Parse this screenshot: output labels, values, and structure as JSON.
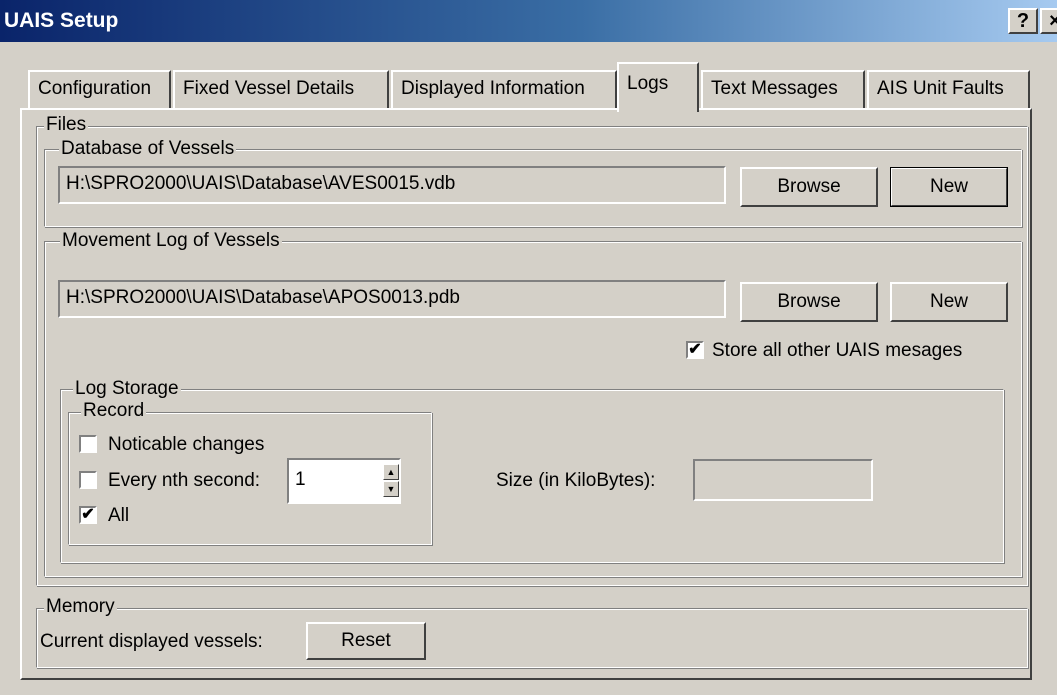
{
  "window": {
    "title": "UAIS Setup",
    "help_glyph": "?",
    "close_glyph": "×"
  },
  "tabs": [
    {
      "label": "Configuration",
      "active": false
    },
    {
      "label": "Fixed Vessel Details",
      "active": false
    },
    {
      "label": "Displayed Information",
      "active": false
    },
    {
      "label": "Logs",
      "active": true
    },
    {
      "label": "Text Messages",
      "active": false
    },
    {
      "label": "AIS Unit Faults",
      "active": false
    }
  ],
  "files": {
    "legend": "Files",
    "database": {
      "legend": "Database of Vessels",
      "path": "H:\\SPRO2000\\UAIS\\Database\\AVES0015.vdb",
      "browse_label": "Browse",
      "new_label": "New"
    },
    "movement": {
      "legend": "Movement Log of Vessels",
      "path": "H:\\SPRO2000\\UAIS\\Database\\APOS0013.pdb",
      "browse_label": "Browse",
      "new_label": "New",
      "store_all_label": "Store all other UAIS mesages",
      "store_all_checked": true,
      "log_storage": {
        "legend": "Log Storage",
        "record": {
          "legend": "Record",
          "noticable_label": "Noticable changes",
          "noticable_checked": false,
          "every_nth_label": "Every nth second:",
          "every_nth_checked": false,
          "every_nth_value": "1",
          "all_label": "All",
          "all_checked": true
        },
        "size_label": "Size (in KiloBytes):",
        "size_value": ""
      }
    }
  },
  "memory": {
    "legend": "Memory",
    "current_label": "Current displayed vessels:",
    "reset_label": "Reset"
  },
  "check_glyph": "✔"
}
